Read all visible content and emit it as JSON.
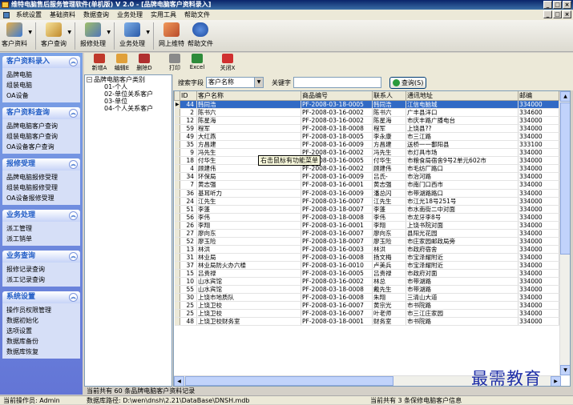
{
  "window": {
    "title": "维特电脑售后服务管理软件(单机版) V 2.0 - [品牌电脑客户资料录入]"
  },
  "menu": [
    "系统设置",
    "基础资料",
    "数据查询",
    "业务处理",
    "实用工具",
    "帮助文件"
  ],
  "toolbar": [
    "客户资料",
    "客户查询",
    "报修处理",
    "业务处理",
    "网上维特",
    "帮助文件"
  ],
  "sidebar": [
    {
      "title": "客户资料录入",
      "items": [
        "品牌电脑",
        "组装电脑",
        "OA设备"
      ]
    },
    {
      "title": "客户资料查询",
      "items": [
        "品牌电脑客户查询",
        "组装电脑客户查询",
        "OA设备客户查询"
      ]
    },
    {
      "title": "报修受理",
      "items": [
        "品牌电脑报修受理",
        "组装电脑报修受理",
        "OA设备报修受理"
      ]
    },
    {
      "title": "业务处理",
      "items": [
        "派工管理",
        "派工销单"
      ]
    },
    {
      "title": "业务查询",
      "items": [
        "报修记录查询",
        "派工记录查询"
      ]
    },
    {
      "title": "系统设置",
      "items": [
        "操作员权限管理",
        "数据初始化",
        "选项设置",
        "数据库备份",
        "数据库恢复"
      ]
    }
  ],
  "actions": [
    "新增A",
    "编辑E",
    "删除D",
    "打印",
    "Excel",
    "关闭X"
  ],
  "tree": {
    "root": "品牌电脑客户类别",
    "children": [
      "01-个人",
      "02-单位关系客户",
      "03-单位",
      "04-个人关系客户"
    ]
  },
  "search": {
    "field_label": "搜索字段",
    "field_value": "客户名称",
    "keyword_label": "关键字",
    "button": "查询(S)"
  },
  "grid": {
    "columns": [
      "ID",
      "客户名称",
      "商品编号",
      "联系人",
      "通讯地址",
      "邮编"
    ],
    "selected_row": 0,
    "rows": [
      [
        "44",
        "韩同浩",
        "PF-2008-03-18-0005",
        "韩同浩",
        "江信电脑城",
        "334000"
      ],
      [
        "2",
        "陈书六",
        "PF-2008-03-16-0002",
        "陈书六",
        "广丰县洋口",
        "334600"
      ],
      [
        "12",
        "陈星海",
        "PF-2008-03-16-0002",
        "陈星海",
        "市庆丰路广播电台",
        "334000"
      ],
      [
        "59",
        "程军",
        "PF-2008-03-18-0008",
        "程军",
        "上饶县??",
        "334000"
      ],
      [
        "49",
        "大红燕",
        "PF-2008-03-18-0005",
        "李永康",
        "市三江路",
        "334000"
      ],
      [
        "35",
        "方昌建",
        "PF-2008-03-16-0009",
        "方昌建",
        "送桥一一鄱阳县",
        "333100"
      ],
      [
        "9",
        "冯先生",
        "PF-2008-03-16-0002",
        "冯先生",
        "市灯具市场",
        "334000"
      ],
      [
        "18",
        "付华生",
        "PF-2008-03-16-0005",
        "付华生",
        "市粮食局宿舍9号2单元602市",
        "334000"
      ],
      [
        "4",
        "顾建伟",
        "PF-2008-03-16-0002",
        "顾建伟",
        "市毛纺厂路口",
        "334000"
      ],
      [
        "34",
        "环保局",
        "PF-2008-03-16-0009",
        "吕氏-",
        "市治河路",
        "334000"
      ],
      [
        "7",
        "黄志强",
        "PF-2008-03-16-0001",
        "黄志强",
        "市南门口西市",
        "334000"
      ],
      [
        "36",
        "基耳听力",
        "PF-2008-03-16-0009",
        "潘总闪",
        "市带湖路路口",
        "334000"
      ],
      [
        "24",
        "江先生",
        "PF-2008-03-16-0007",
        "江先生",
        "市江光18号251号",
        "334000"
      ],
      [
        "51",
        "李蓬",
        "PF-2008-03-18-0007",
        "李蓬",
        "市水南街二中对面",
        "334000"
      ],
      [
        "56",
        "李伟",
        "PF-2008-03-18-0008",
        "李伟",
        "市龙牙李8号",
        "334000"
      ],
      [
        "26",
        "李翔",
        "PF-2008-03-16-0001",
        "李翔",
        "上饶书院对面",
        "334000"
      ],
      [
        "27",
        "廖向东",
        "PF-2008-03-16-0007",
        "廖向东",
        "县阳光花园",
        "334000"
      ],
      [
        "52",
        "廖玉险",
        "PF-2008-03-18-0007",
        "廖玉险",
        "市庄家园邮政局旁",
        "334000"
      ],
      [
        "13",
        "林洪",
        "PF-2008-03-16-0003",
        "林洪",
        "市政府宿舍",
        "334000"
      ],
      [
        "31",
        "林业局",
        "PF-2008-03-16-0008",
        "扬文梅",
        "市宝泽耀附近",
        "334000"
      ],
      [
        "37",
        "林业局防火办六楼",
        "PF-2008-03-16-0010",
        "卢美兵",
        "市宝泽耀附近",
        "334000"
      ],
      [
        "15",
        "吕贵禄",
        "PF-2008-03-16-0005",
        "吕贵禄",
        "市政府对面",
        "334000"
      ],
      [
        "10",
        "山水宾馆",
        "PF-2008-03-16-0002",
        "林总",
        "市带湖路",
        "334000"
      ],
      [
        "55",
        "山水宾馆",
        "PF-2008-03-18-0008",
        "戴先生",
        "市带湖路",
        "334000"
      ],
      [
        "30",
        "上饶市地质队",
        "PF-2008-03-16-0008",
        "朱翔",
        "三清山大道",
        "334000"
      ],
      [
        "25",
        "上饶卫校",
        "PF-2008-03-16-0007",
        "黄宗光",
        "市书院路",
        "334000"
      ],
      [
        "25",
        "上饶卫校",
        "PF-2008-03-16-0007",
        "叶老师",
        "市三江庄家园",
        "334000"
      ],
      [
        "48",
        "上饶卫校财务室",
        "PF-2008-03-18-0001",
        "财务室",
        "市书院路",
        "334000"
      ]
    ]
  },
  "tooltip": "右击鼠标有功能菜单",
  "record_count": "当前共有 60 条品牌电脑客户资料记录",
  "status": {
    "operator": "当前操作员: Admin",
    "db_path": "数据库路径: D:\\wen\\dnsh\\2.21\\DataBase\\DNSH.mdb",
    "right": "当前共有 3 条保修电脑客户信息"
  },
  "watermark": "最需教育"
}
